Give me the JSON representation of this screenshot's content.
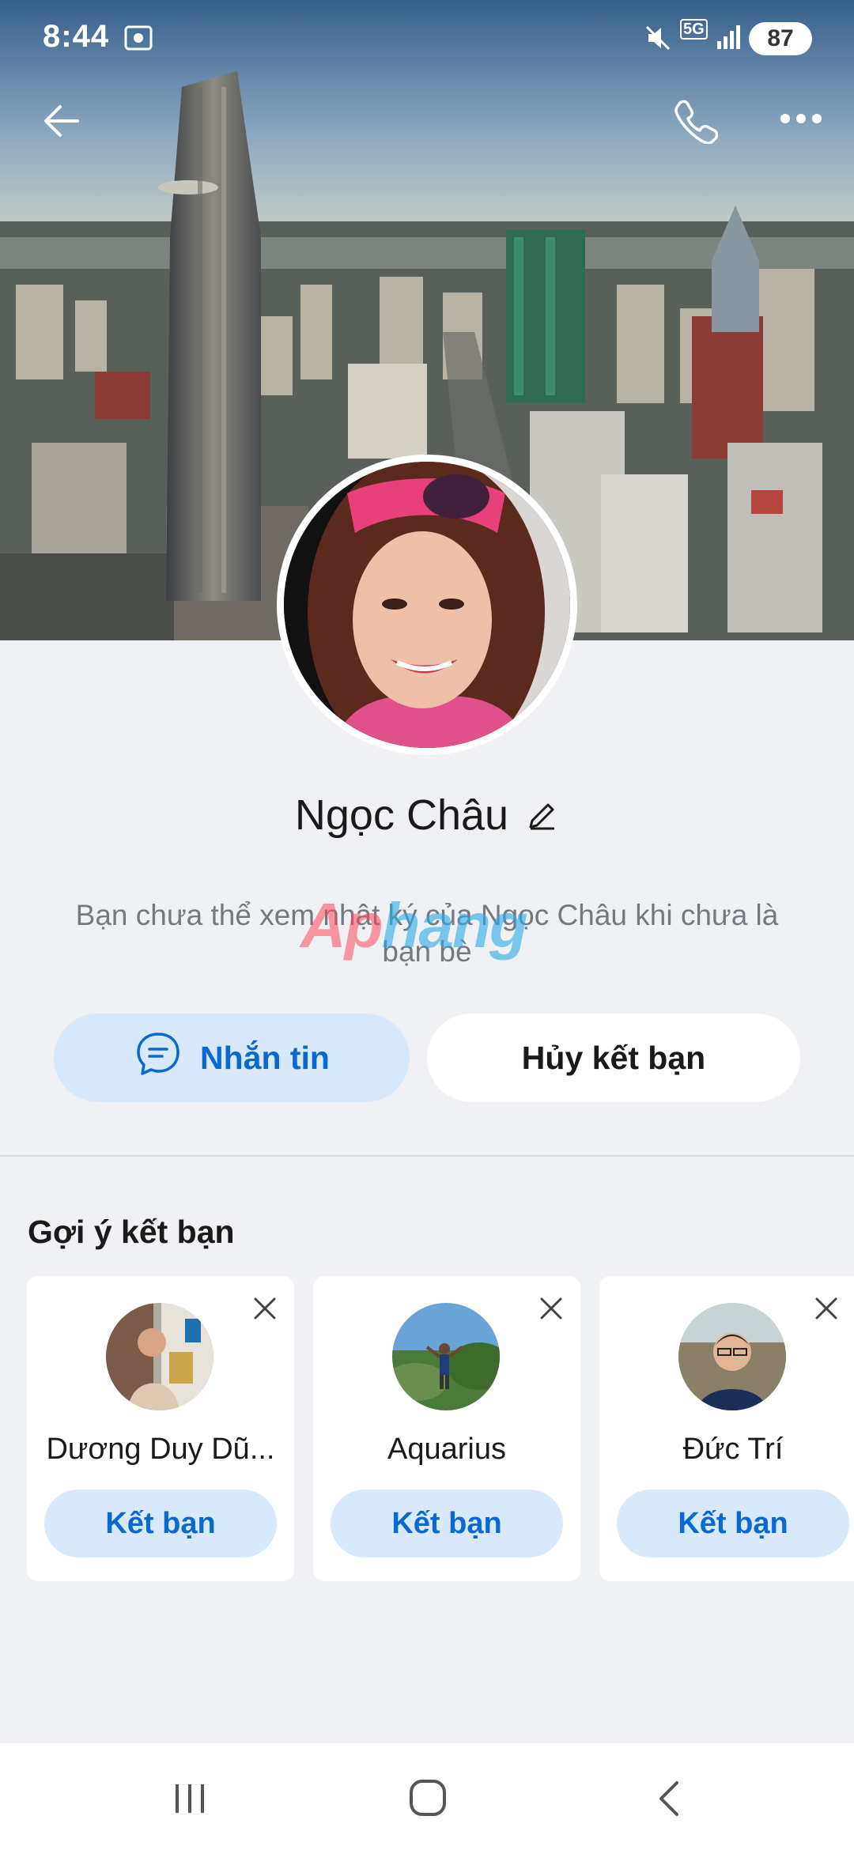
{
  "status_bar": {
    "time": "8:44",
    "network": "5G",
    "battery": "87"
  },
  "profile": {
    "name": "Ngọc Châu",
    "info_text": "Bạn chưa thể xem nhật ký của Ngọc Châu khi chưa là bạn bè",
    "message_button": "Nhắn tin",
    "unfriend_button": "Hủy kết bạn"
  },
  "watermark": {
    "part1": "Ap",
    "part2": "hang"
  },
  "suggestions": {
    "title": "Gợi ý kết bạn",
    "add_label": "Kết bạn",
    "items": [
      {
        "name": "Dương Duy Dũ..."
      },
      {
        "name": "Aquarius"
      },
      {
        "name": "Đức Trí"
      }
    ]
  },
  "colors": {
    "accent": "#0a68d1",
    "accent_bg": "#d9e9fc",
    "page_bg": "#f0f1f5"
  },
  "icons": [
    "back-arrow-icon",
    "phone-icon",
    "more-icon",
    "message-icon",
    "close-icon",
    "edit-icon",
    "recents-icon",
    "home-icon",
    "back-icon"
  ]
}
